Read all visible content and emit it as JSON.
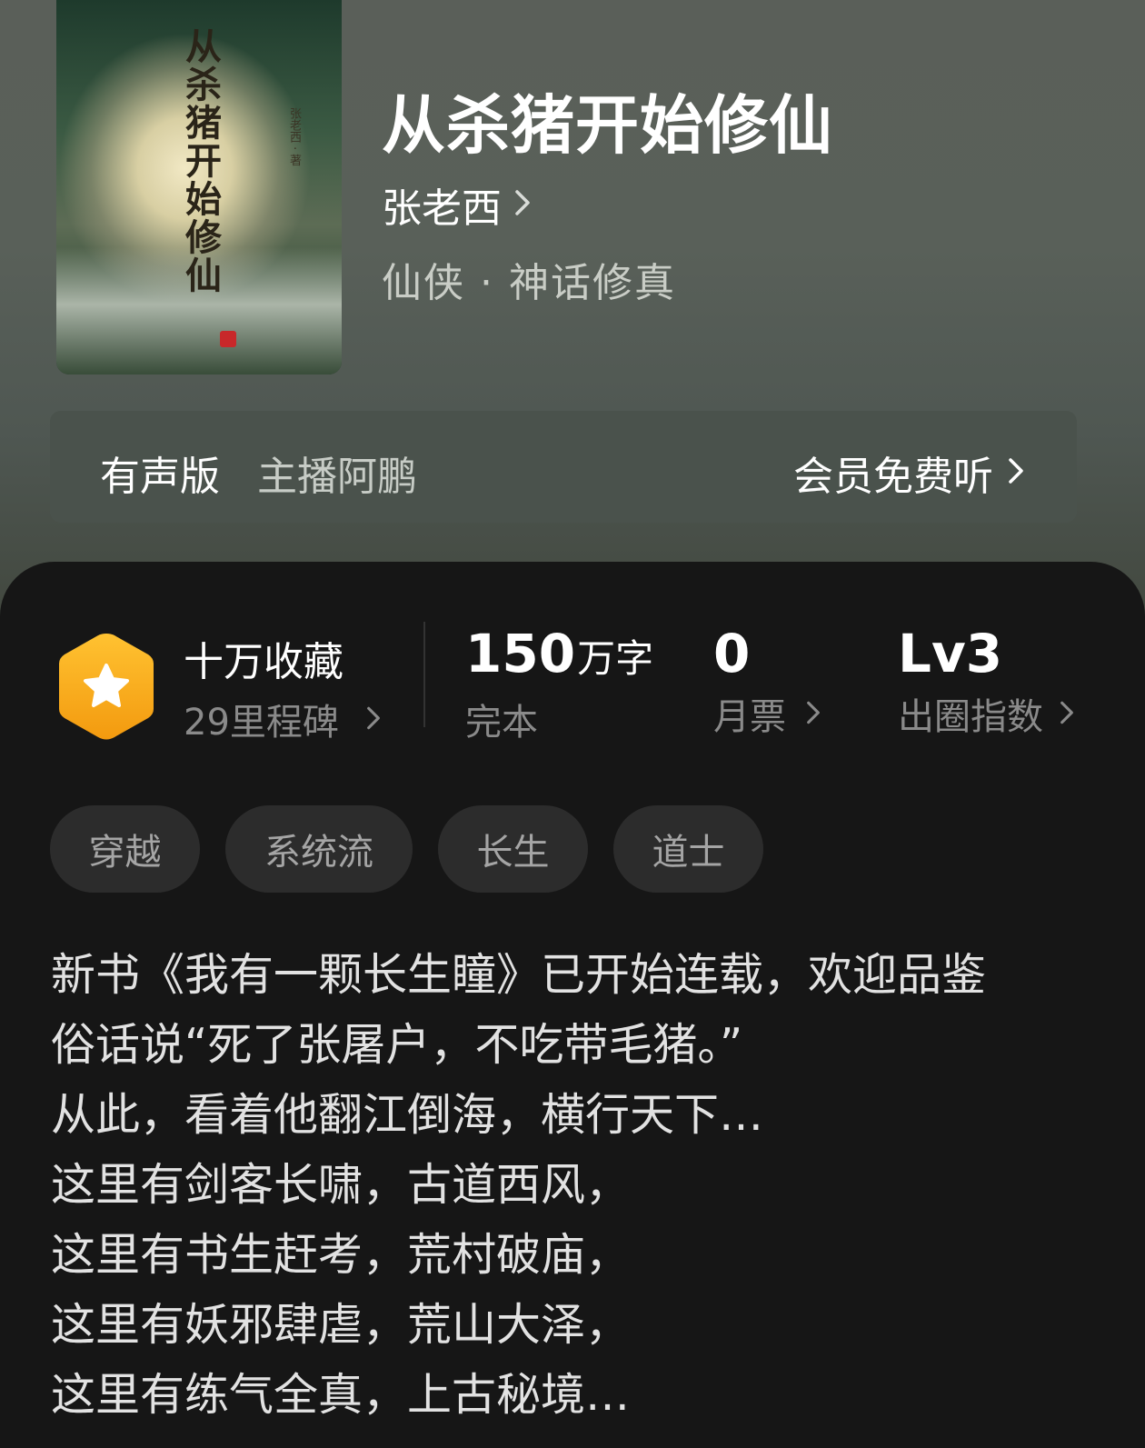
{
  "book": {
    "title": "从杀猪开始修仙",
    "author": "张老西",
    "genre": "仙侠 · 神话修真",
    "cover_title": "从杀猪开始修仙",
    "cover_author": "张老西 · 著"
  },
  "audio": {
    "label": "有声版",
    "host": "主播阿鹏",
    "cta": "会员免费听"
  },
  "stats": {
    "favorites": "十万收藏",
    "milestones": "29里程碑",
    "word_count": "150",
    "word_unit": "万字",
    "status": "完本",
    "monthly_votes": "0",
    "monthly_votes_label": "月票",
    "level": "Lv3",
    "level_label": "出圈指数"
  },
  "tags": [
    "穿越",
    "系统流",
    "长生",
    "道士"
  ],
  "description": [
    "新书《我有一颗长生瞳》已开始连载，欢迎品鉴",
    "俗话说“死了张屠户，不吃带毛猪。”",
    "从此，看着他翻江倒海，横行天下…",
    "这里有剑客长啸，古道西风，",
    "这里有书生赶考，荒村破庙，",
    "这里有妖邪肆虐，荒山大泽，",
    "这里有练气全真，上古秘境…"
  ],
  "colors": {
    "badge": "#f7a91c",
    "sheet": "#161616",
    "tag_bg": "#2c2c2c"
  },
  "icons": {
    "badge": "star-hexagon-icon",
    "chevron": "chevron-right-icon"
  }
}
